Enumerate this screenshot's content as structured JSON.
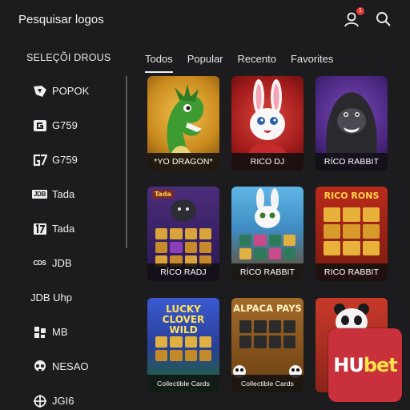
{
  "header": {
    "title": "Pesquisar logos",
    "notification_count": "1"
  },
  "sidebar": {
    "title": "SELEÇÕI DROUS",
    "items": [
      {
        "label": "POPOK",
        "icon": "popok-logo-icon"
      },
      {
        "label": "G759",
        "icon": "g759-logo-icon"
      },
      {
        "label": "G759",
        "icon": "g7-logo-icon"
      },
      {
        "label": "Tada",
        "icon": "jdb-logo-icon",
        "logo_text": "JDB"
      },
      {
        "label": "Tada",
        "icon": "tada-17-logo-icon"
      },
      {
        "label": "JDB",
        "icon": "cds-logo-icon",
        "logo_text": "CDS"
      },
      {
        "label": "JDB Uhp",
        "icon": ""
      },
      {
        "label": "MB",
        "icon": "mb-logo-icon"
      },
      {
        "label": "NESAO",
        "icon": "skull-logo-icon"
      },
      {
        "label": "JGI6",
        "icon": "jgi-logo-icon"
      }
    ]
  },
  "tabs": [
    {
      "label": "Todos",
      "active": true
    },
    {
      "label": "Popular",
      "active": false
    },
    {
      "label": "Recento",
      "active": false
    },
    {
      "label": "Favorites",
      "active": false
    }
  ],
  "games": [
    {
      "label": "*YO DRAGON*",
      "art": "dragon"
    },
    {
      "label": "RICO DJ",
      "art": "rabbit-red"
    },
    {
      "label": "RÍCO RABBIT",
      "art": "gorilla"
    },
    {
      "label": "RÍCO RADJ",
      "art": "gorilla-slot",
      "art_title": "Tada"
    },
    {
      "label": "RÍCO RABBIT",
      "art": "rabbit-slot"
    },
    {
      "label": "RICO RABBIT",
      "art": "rico-rons-slot",
      "art_title": "RICO RONS"
    },
    {
      "label": "Collectible Cards",
      "art": "lucky-clover",
      "art_title": "LUCKY CLOVER WILD"
    },
    {
      "label": "Collectible Cards",
      "art": "alpaca",
      "art_title": "ALPACA PAYS"
    },
    {
      "label": "",
      "art": "panda"
    }
  ],
  "promo_logo": {
    "part1": "HU",
    "part2": "bet"
  },
  "colors": {
    "background": "#1c1c1e",
    "brand": "#c8303b",
    "brand_accent": "#ffe14a"
  }
}
